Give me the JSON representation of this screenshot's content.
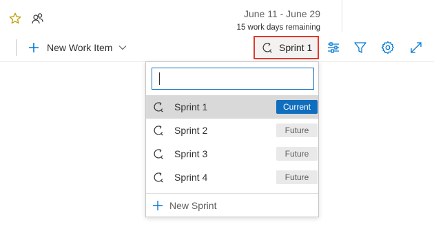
{
  "header": {
    "favorite_icon": "star-icon",
    "members_icon": "people-icon",
    "date_range": "June 11 - June 29",
    "days_remaining": "15 work days remaining"
  },
  "toolbar": {
    "new_work_item_label": "New Work Item",
    "sprint_picker_label": "Sprint 1",
    "icons": [
      "view-options-icon",
      "filter-icon",
      "gear-icon",
      "expand-icon"
    ],
    "accent_color": "#0078d4",
    "highlight_color": "#e0382b"
  },
  "sprint_dropdown": {
    "search_value": "",
    "items": [
      {
        "label": "Sprint 1",
        "status": "Current",
        "selected": true
      },
      {
        "label": "Sprint 2",
        "status": "Future",
        "selected": false
      },
      {
        "label": "Sprint 3",
        "status": "Future",
        "selected": false
      },
      {
        "label": "Sprint 4",
        "status": "Future",
        "selected": false
      }
    ],
    "new_sprint_label": "New Sprint"
  }
}
